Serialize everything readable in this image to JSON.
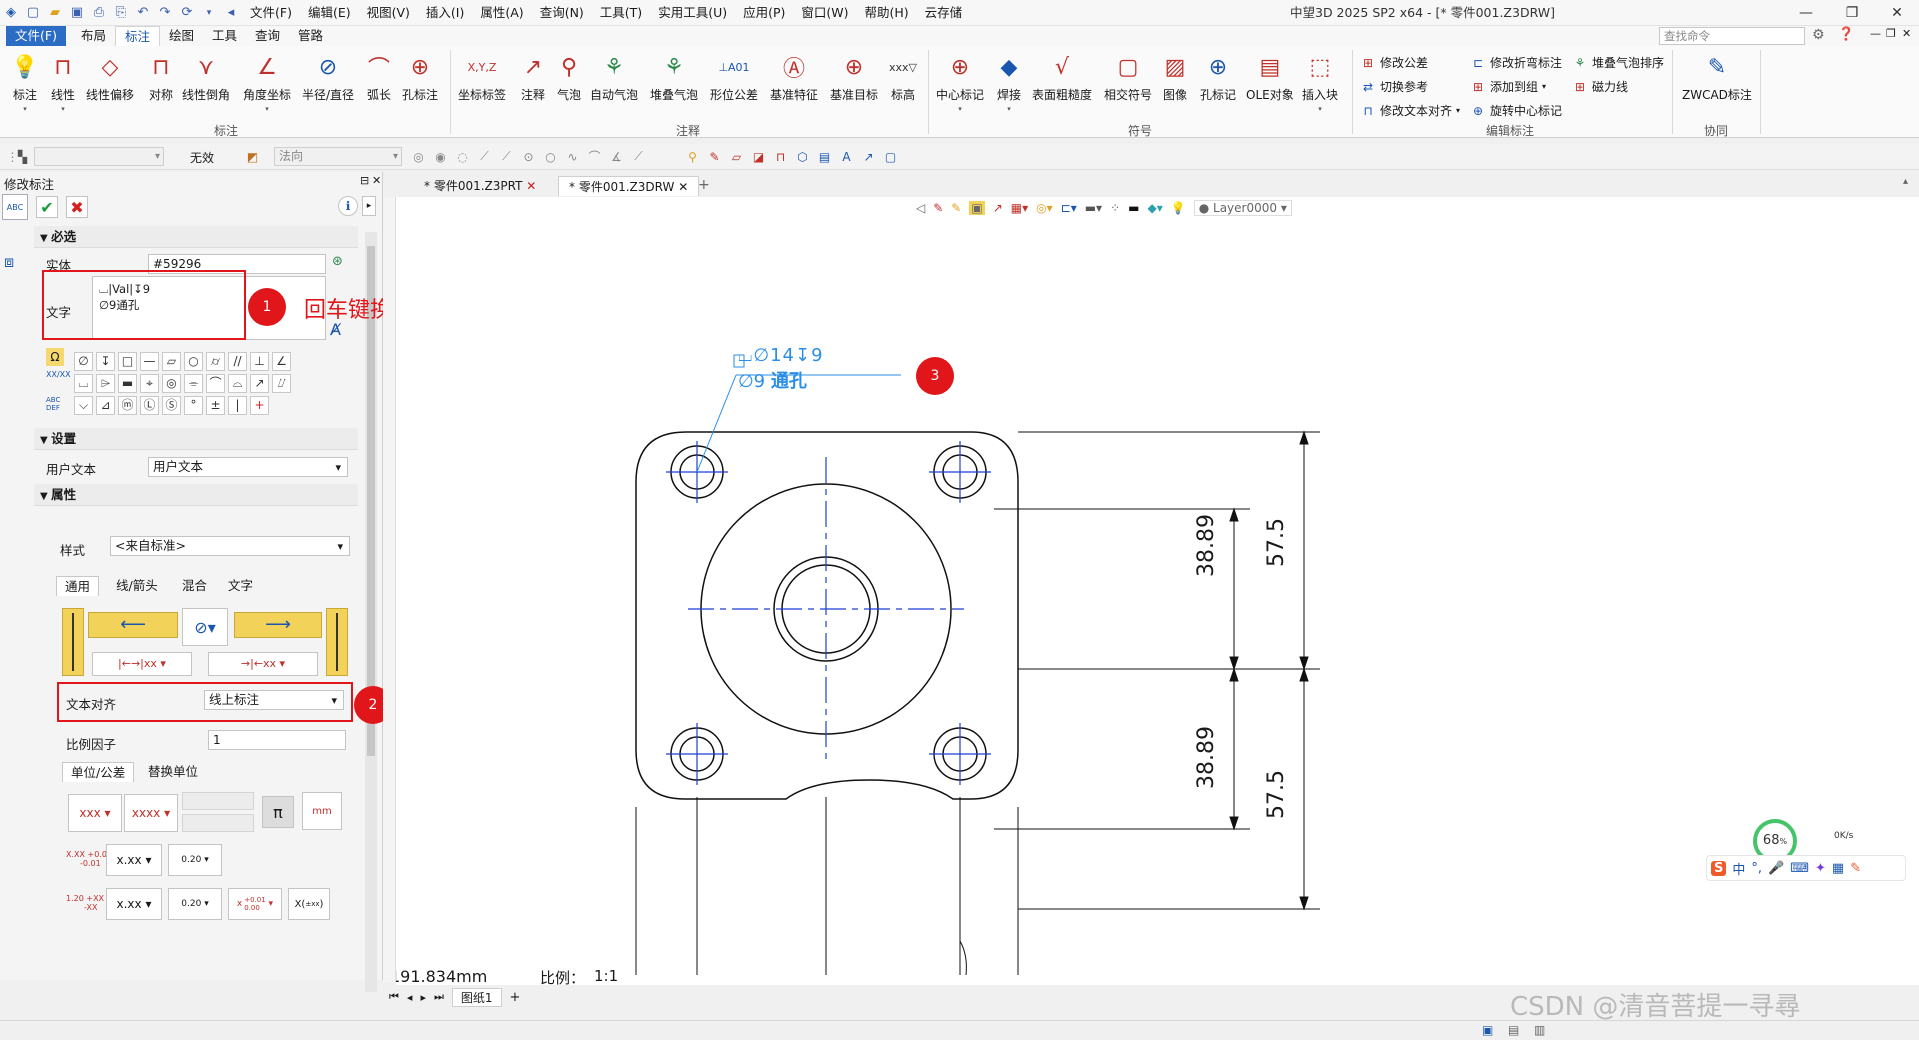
{
  "titlebar": {
    "menus": [
      "文件(F)",
      "编辑(E)",
      "视图(V)",
      "插入(I)",
      "属性(A)",
      "查询(N)",
      "工具(T)",
      "实用工具(U)",
      "应用(P)",
      "窗口(W)",
      "帮助(H)",
      "云存储"
    ],
    "window_title": "中望3D 2025 SP2 x64 - [* 零件001.Z3DRW]"
  },
  "ribbon_tabs": [
    "文件(F)",
    "布局",
    "标注",
    "绘图",
    "工具",
    "查询",
    "管路"
  ],
  "search": {
    "placeholder": "查找命令"
  },
  "ribbon": {
    "groups": {
      "annotate": "标注",
      "notes": "注释",
      "symbols": "符号",
      "edit": "编辑标注",
      "collab": "协同"
    },
    "annotate_buttons": [
      "标注",
      "线性",
      "线性偏移",
      "对称",
      "线性倒角",
      "角度坐标",
      "半径/直径",
      "弧长",
      "孔标注"
    ],
    "notes_buttons": [
      "坐标标签",
      "注释",
      "气泡",
      "自动气泡",
      "堆叠气泡",
      "形位公差",
      "基准特征",
      "基准目标",
      "标高"
    ],
    "symbol_buttons": [
      "中心标记",
      "焊接",
      "表面粗糙度",
      "相交符号",
      "图像",
      "孔标记",
      "OLE对象",
      "插入块"
    ],
    "edit_buttons": [
      "修改公差",
      "修改折弯标注",
      "堆叠气泡排序",
      "切换参考",
      "添加到组",
      "磁力线",
      "修改文本对齐",
      "旋转中心标记"
    ],
    "collab_button": "ZWCAD标注"
  },
  "toolbar2": {
    "combo1": "",
    "invalid_label": "无效",
    "combo2": "法向"
  },
  "panel": {
    "title": "修改标注",
    "required_section": "必选",
    "entity_label": "实体",
    "entity_value": "#59296",
    "text_label": "文字",
    "text_line1": "⌴|Val|↧9",
    "text_line2": "∅9通孔",
    "symbols_row1": [
      "∅",
      "↧",
      "□",
      "—",
      "▱",
      "○",
      "⌭",
      "//",
      "⊥",
      "∠"
    ],
    "symbols_row2": [
      "⌴",
      "⌲",
      "▬",
      "⌖",
      "◎",
      "⌯",
      "⌒",
      "⌓",
      "↗",
      "⌰"
    ],
    "symbols_row3": [
      "⌵",
      "⊿",
      "ⓜ",
      "Ⓛ",
      "Ⓢ",
      "°",
      "±",
      "|",
      "+"
    ],
    "settings_section": "设置",
    "user_text_label": "用户文本",
    "user_text_value": "用户文本",
    "attr_section": "属性",
    "style_label": "样式",
    "style_value": "<来自标准>",
    "subtabs": [
      "通用",
      "线/箭头",
      "混合",
      "文字"
    ],
    "align_label": "文本对齐",
    "align_value": "线上标注",
    "scale_label": "比例因子",
    "scale_value": "1",
    "unit_tabs": [
      "单位/公差",
      "替换单位"
    ],
    "fmt1": "xxx",
    "fmt2": "xxxx",
    "fmt3": "x.xx",
    "fmt4": "x.xx",
    "tol_a": "0.20",
    "tol_b": "0.20",
    "x_label": "xx",
    "x_label2": "xx",
    "pi": "π",
    "mm_label": "mm",
    "tol_x": "x",
    "tol_x_upper": "+0.01",
    "tol_x_lower": "0.00",
    "paren_x": "X(",
    "paren_x_inner": "±xx",
    "xx_stack_top": "+0.01",
    "xx_stack_bot": "-0.01",
    "xx_prefix": "X.XX",
    "stack2_prefix": "1.20",
    "stack2_top": "+XX",
    "stack2_bot": "-XX"
  },
  "annotations": {
    "note1": "1",
    "note1_text": "回车键换行",
    "note2": "2",
    "note3": "3"
  },
  "doc_tabs": [
    "* 零件001.Z3PRT",
    "* 零件001.Z3DRW"
  ],
  "canvas_toolbar": {
    "layer": "Layer0000"
  },
  "drawing": {
    "callout_line1": "⌴∅14↧9",
    "callout_line2_prefix": "∅9",
    "callout_line2_suffix": "通孔",
    "dim_38_top": "38.89",
    "dim_57_top": "57.5",
    "dim_38_bot": "38.89",
    "dim_57_bot": "57.5",
    "coord": "191.834mm",
    "scale_label": "比例：",
    "scale_value": "1:1",
    "sheet": "图纸1",
    "edge_labels": [
      "0",
      "0",
      "0",
      "0",
      "0"
    ]
  },
  "tray": {
    "percent": "68",
    "netspeed": "0K/s",
    "ime": "中"
  },
  "watermark": "CSDN @清音菩提一寻尋",
  "colors": {
    "accent": "#2b6cc4",
    "red": "#e0161b",
    "drawing_blue": "#1f3fd6",
    "callout_blue": "#2a8ee8"
  }
}
